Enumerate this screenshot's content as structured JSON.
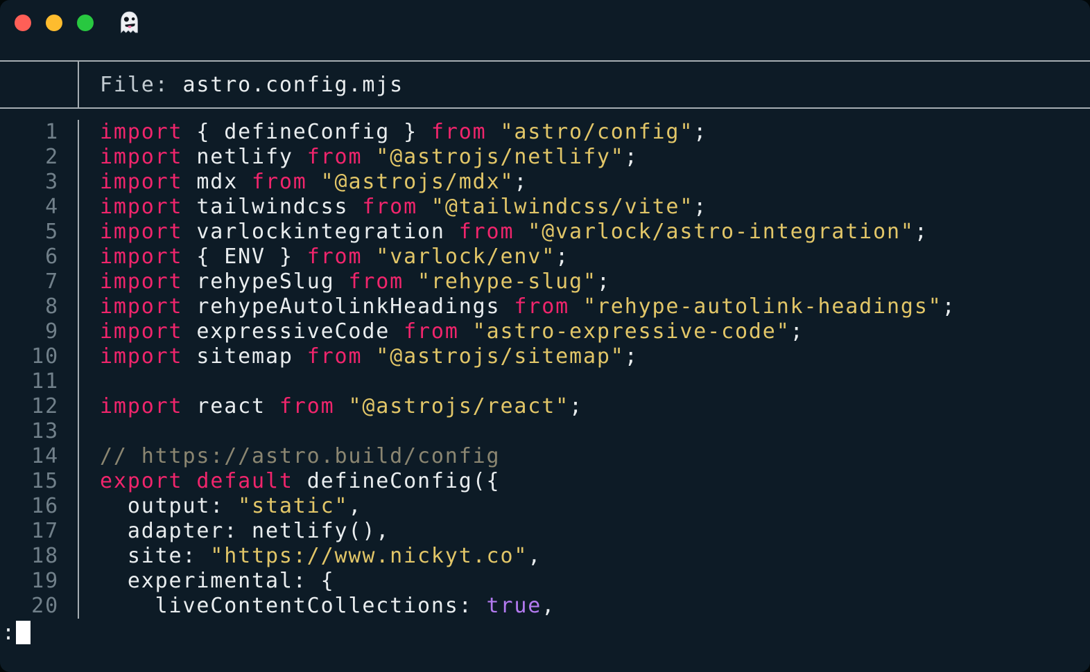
{
  "palette": {
    "bg": "#0d1b26",
    "rule": "#a6aeb3",
    "fg": "#e9edef",
    "kw": "#f0256c",
    "str": "#e2c668",
    "cmt": "#8b8671",
    "bool": "#b37af0",
    "ln": "#71808a",
    "header-label": "#c3ccd2",
    "tl-red": "#ff5f57",
    "tl-yellow": "#febc2e",
    "tl-green": "#28c840"
  },
  "titlebar": {
    "icon": "ghost",
    "buttons": [
      "close",
      "minimize",
      "zoom"
    ]
  },
  "header": {
    "file_label": "File: ",
    "file_name": "astro.config.mjs"
  },
  "code": {
    "lines": [
      {
        "number": "1",
        "tokens": [
          [
            "kw",
            "import"
          ],
          [
            "pl",
            " { defineConfig } "
          ],
          [
            "kw",
            "from"
          ],
          [
            "pl",
            " "
          ],
          [
            "str",
            "\"astro/config\""
          ],
          [
            "pl",
            ";"
          ]
        ]
      },
      {
        "number": "2",
        "tokens": [
          [
            "kw",
            "import"
          ],
          [
            "pl",
            " netlify "
          ],
          [
            "kw",
            "from"
          ],
          [
            "pl",
            " "
          ],
          [
            "str",
            "\"@astrojs/netlify\""
          ],
          [
            "pl",
            ";"
          ]
        ]
      },
      {
        "number": "3",
        "tokens": [
          [
            "kw",
            "import"
          ],
          [
            "pl",
            " mdx "
          ],
          [
            "kw",
            "from"
          ],
          [
            "pl",
            " "
          ],
          [
            "str",
            "\"@astrojs/mdx\""
          ],
          [
            "pl",
            ";"
          ]
        ]
      },
      {
        "number": "4",
        "tokens": [
          [
            "kw",
            "import"
          ],
          [
            "pl",
            " tailwindcss "
          ],
          [
            "kw",
            "from"
          ],
          [
            "pl",
            " "
          ],
          [
            "str",
            "\"@tailwindcss/vite\""
          ],
          [
            "pl",
            ";"
          ]
        ]
      },
      {
        "number": "5",
        "tokens": [
          [
            "kw",
            "import"
          ],
          [
            "pl",
            " varlockintegration "
          ],
          [
            "kw",
            "from"
          ],
          [
            "pl",
            " "
          ],
          [
            "str",
            "\"@varlock/astro-integration\""
          ],
          [
            "pl",
            ";"
          ]
        ]
      },
      {
        "number": "6",
        "tokens": [
          [
            "kw",
            "import"
          ],
          [
            "pl",
            " { ENV } "
          ],
          [
            "kw",
            "from"
          ],
          [
            "pl",
            " "
          ],
          [
            "str",
            "\"varlock/env\""
          ],
          [
            "pl",
            ";"
          ]
        ]
      },
      {
        "number": "7",
        "tokens": [
          [
            "kw",
            "import"
          ],
          [
            "pl",
            " rehypeSlug "
          ],
          [
            "kw",
            "from"
          ],
          [
            "pl",
            " "
          ],
          [
            "str",
            "\"rehype-slug\""
          ],
          [
            "pl",
            ";"
          ]
        ]
      },
      {
        "number": "8",
        "tokens": [
          [
            "kw",
            "import"
          ],
          [
            "pl",
            " rehypeAutolinkHeadings "
          ],
          [
            "kw",
            "from"
          ],
          [
            "pl",
            " "
          ],
          [
            "str",
            "\"rehype-autolink-headings\""
          ],
          [
            "pl",
            ";"
          ]
        ]
      },
      {
        "number": "9",
        "tokens": [
          [
            "kw",
            "import"
          ],
          [
            "pl",
            " expressiveCode "
          ],
          [
            "kw",
            "from"
          ],
          [
            "pl",
            " "
          ],
          [
            "str",
            "\"astro-expressive-code\""
          ],
          [
            "pl",
            ";"
          ]
        ]
      },
      {
        "number": "10",
        "tokens": [
          [
            "kw",
            "import"
          ],
          [
            "pl",
            " sitemap "
          ],
          [
            "kw",
            "from"
          ],
          [
            "pl",
            " "
          ],
          [
            "str",
            "\"@astrojs/sitemap\""
          ],
          [
            "pl",
            ";"
          ]
        ]
      },
      {
        "number": "11",
        "tokens": []
      },
      {
        "number": "12",
        "tokens": [
          [
            "kw",
            "import"
          ],
          [
            "pl",
            " react "
          ],
          [
            "kw",
            "from"
          ],
          [
            "pl",
            " "
          ],
          [
            "str",
            "\"@astrojs/react\""
          ],
          [
            "pl",
            ";"
          ]
        ]
      },
      {
        "number": "13",
        "tokens": []
      },
      {
        "number": "14",
        "tokens": [
          [
            "cmt",
            "// https://astro.build/config"
          ]
        ]
      },
      {
        "number": "15",
        "tokens": [
          [
            "kw",
            "export"
          ],
          [
            "pl",
            " "
          ],
          [
            "kw",
            "default"
          ],
          [
            "pl",
            " defineConfig({"
          ]
        ]
      },
      {
        "number": "16",
        "tokens": [
          [
            "pl",
            "  output: "
          ],
          [
            "str",
            "\"static\""
          ],
          [
            "pl",
            ","
          ]
        ]
      },
      {
        "number": "17",
        "tokens": [
          [
            "pl",
            "  adapter: netlify(),"
          ]
        ]
      },
      {
        "number": "18",
        "tokens": [
          [
            "pl",
            "  site: "
          ],
          [
            "str",
            "\"https://www.nickyt.co\""
          ],
          [
            "pl",
            ","
          ]
        ]
      },
      {
        "number": "19",
        "tokens": [
          [
            "pl",
            "  experimental: {"
          ]
        ]
      },
      {
        "number": "20",
        "tokens": [
          [
            "pl",
            "    liveContentCollections: "
          ],
          [
            "bool",
            "true"
          ],
          [
            "pl",
            ","
          ]
        ]
      }
    ]
  },
  "pager": {
    "prompt": ":"
  }
}
